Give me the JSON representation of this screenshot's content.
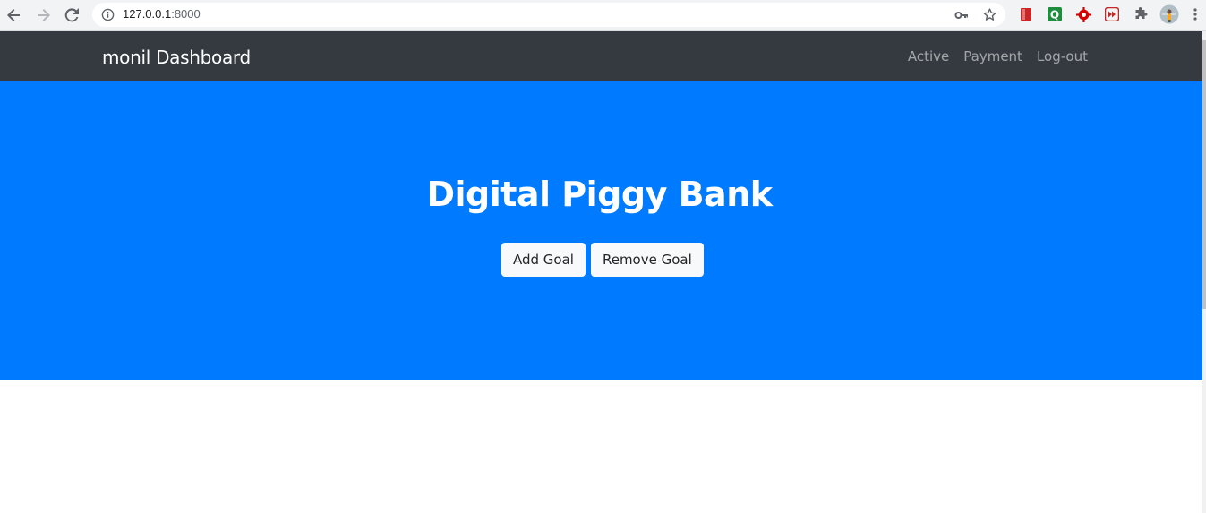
{
  "browser": {
    "url_host": "127.0.0.1",
    "url_port": ":8000"
  },
  "navbar": {
    "brand": "monil Dashboard",
    "links": [
      "Active",
      "Payment",
      "Log-out"
    ]
  },
  "hero": {
    "title": "Digital Piggy Bank",
    "buttons": [
      "Add Goal",
      "Remove Goal"
    ]
  },
  "colors": {
    "navbar_bg": "#343a40",
    "hero_bg": "#007bff",
    "button_bg": "#f8f9fa"
  },
  "icons": [
    "back-icon",
    "forward-icon",
    "reload-icon",
    "info-icon",
    "key-icon",
    "star-icon",
    "bookmark-ext-icon",
    "q-ext-icon",
    "gear-ext-icon",
    "media-ext-icon",
    "puzzle-icon",
    "profile-avatar",
    "menu-icon"
  ]
}
